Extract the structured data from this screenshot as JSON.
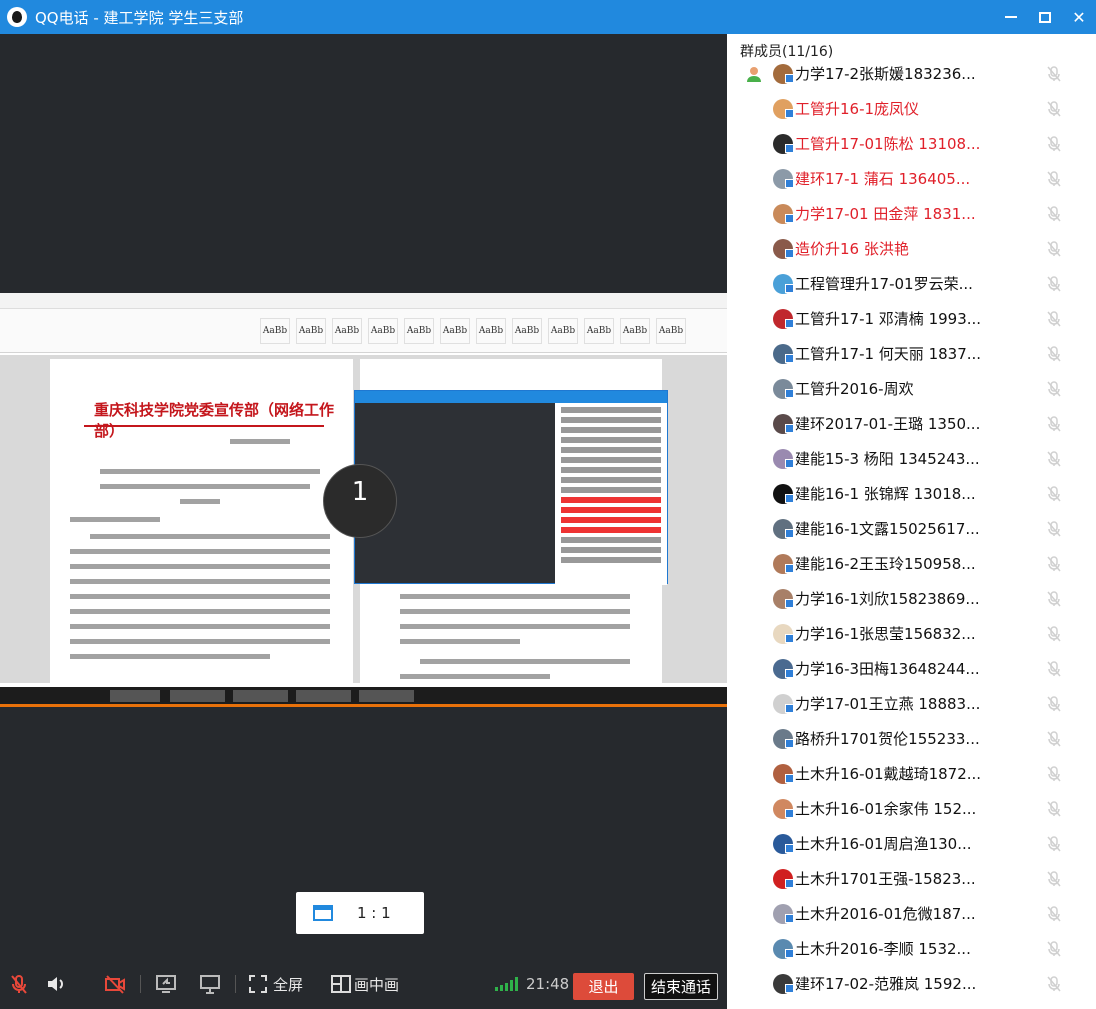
{
  "window": {
    "title": "QQ电话 - 建工学院 学生三支部",
    "controls": [
      "minimize",
      "maximize",
      "close"
    ]
  },
  "shared_screen": {
    "doc_title": "重庆科技学院党委宣传部（网络工作部）",
    "countdown": "1"
  },
  "ratio_popup": {
    "label": "1 : 1",
    "icon": "window-icon"
  },
  "controls": {
    "fullscreen_label": "全屏",
    "pip_label": "画中画",
    "time": "21:48",
    "exit_label": "退出",
    "end_label": "结束通话",
    "signal_bars": 5
  },
  "members": {
    "header": "群成员(11/16)",
    "items": [
      {
        "name": "力学17-2张斯媛183236...",
        "highlight": false,
        "avatar": "#a36b3c",
        "self": true
      },
      {
        "name": "工管升16-1庞凤仪",
        "highlight": true,
        "avatar": "#e0a060"
      },
      {
        "name": "工管升17-01陈松 13108...",
        "highlight": true,
        "avatar": "#2b2b2b"
      },
      {
        "name": "建环17-1  蒲石  136405...",
        "highlight": true,
        "avatar": "#8c9aa8"
      },
      {
        "name": "力学17-01  田金萍 1831...",
        "highlight": true,
        "avatar": "#c98a5a"
      },
      {
        "name": "造价升16 张洪艳",
        "highlight": true,
        "avatar": "#8a5a4a"
      },
      {
        "name": "工程管理升17-01罗云荣...",
        "highlight": false,
        "avatar": "#4aa0d8"
      },
      {
        "name": "工管升17-1 邓清楠 1993...",
        "highlight": false,
        "avatar": "#c0282d"
      },
      {
        "name": "工管升17-1 何天丽 1837...",
        "highlight": false,
        "avatar": "#4b6a8a"
      },
      {
        "name": "工管升2016-周欢",
        "highlight": false,
        "avatar": "#7a8a9a"
      },
      {
        "name": "建环2017-01-王璐 1350...",
        "highlight": false,
        "avatar": "#5a4a4a"
      },
      {
        "name": "建能15-3 杨阳 1345243...",
        "highlight": false,
        "avatar": "#9a8ab0"
      },
      {
        "name": "建能16-1 张锦辉  13018...",
        "highlight": false,
        "avatar": "#111111"
      },
      {
        "name": "建能16-1文露15025617...",
        "highlight": false,
        "avatar": "#607080"
      },
      {
        "name": "建能16-2王玉玲150958...",
        "highlight": false,
        "avatar": "#b07a5a"
      },
      {
        "name": "力学16-1刘欣15823869...",
        "highlight": false,
        "avatar": "#a88068"
      },
      {
        "name": "力学16-1张思莹156832...",
        "highlight": false,
        "avatar": "#e8d8c0"
      },
      {
        "name": "力学16-3田梅13648244...",
        "highlight": false,
        "avatar": "#4a6a90"
      },
      {
        "name": "力学17-01王立燕 18883...",
        "highlight": false,
        "avatar": "#d0d0d0"
      },
      {
        "name": "路桥升1701贺伦155233...",
        "highlight": false,
        "avatar": "#6a7a8a"
      },
      {
        "name": "土木升16-01戴越琦1872...",
        "highlight": false,
        "avatar": "#b06040"
      },
      {
        "name": "土木升16-01余家伟 152...",
        "highlight": false,
        "avatar": "#d08860"
      },
      {
        "name": "土木升16-01周启渔130...",
        "highlight": false,
        "avatar": "#2a5a9a"
      },
      {
        "name": "土木升1701王强-15823...",
        "highlight": false,
        "avatar": "#d02020"
      },
      {
        "name": "土木升2016-01危微187...",
        "highlight": false,
        "avatar": "#a0a0b0"
      },
      {
        "name": "土木升2016-李顺 1532...",
        "highlight": false,
        "avatar": "#5a8ab0"
      },
      {
        "name": "建环17-02-范雅岚 1592...",
        "highlight": false,
        "avatar": "#3a3a3a"
      }
    ]
  }
}
